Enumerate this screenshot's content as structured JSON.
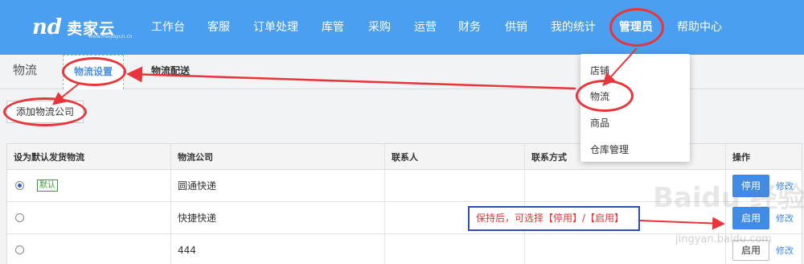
{
  "brand": {
    "mark": "nd",
    "name": "卖家云",
    "sub": "www.maijiayun.cn"
  },
  "nav": {
    "items": [
      "工作台",
      "客服",
      "订单处理",
      "库管",
      "采购",
      "运营",
      "财务",
      "供销",
      "我的统计",
      "管理员",
      "帮助中心"
    ]
  },
  "subheader": {
    "title": "物流",
    "tabs": [
      "物流设置",
      "物流配送"
    ]
  },
  "toolbar": {
    "add_label": "添加物流公司"
  },
  "table": {
    "headers": [
      "设为默认发货物流",
      "物流公司",
      "联系人",
      "联系方式",
      "操作"
    ],
    "default_badge": "默认",
    "rows": [
      {
        "company": "圆通快递",
        "action": "停用",
        "edit": "修改"
      },
      {
        "company": "快捷快递",
        "action": "启用",
        "edit": "修改"
      },
      {
        "company": "444",
        "action": "启用",
        "edit": "修改"
      }
    ]
  },
  "dropdown": {
    "items": [
      "店铺",
      "物流",
      "商品",
      "仓库管理"
    ]
  },
  "annotation": {
    "text": "保持后，可选择【停用】/【启用】"
  },
  "watermark": {
    "text": "Baidu 经验",
    "url": "jingyan.baidu.com"
  },
  "colors": {
    "nav_bg": "#4a9ff0",
    "accent": "#3f8be6",
    "highlight_red": "#e8343a"
  }
}
